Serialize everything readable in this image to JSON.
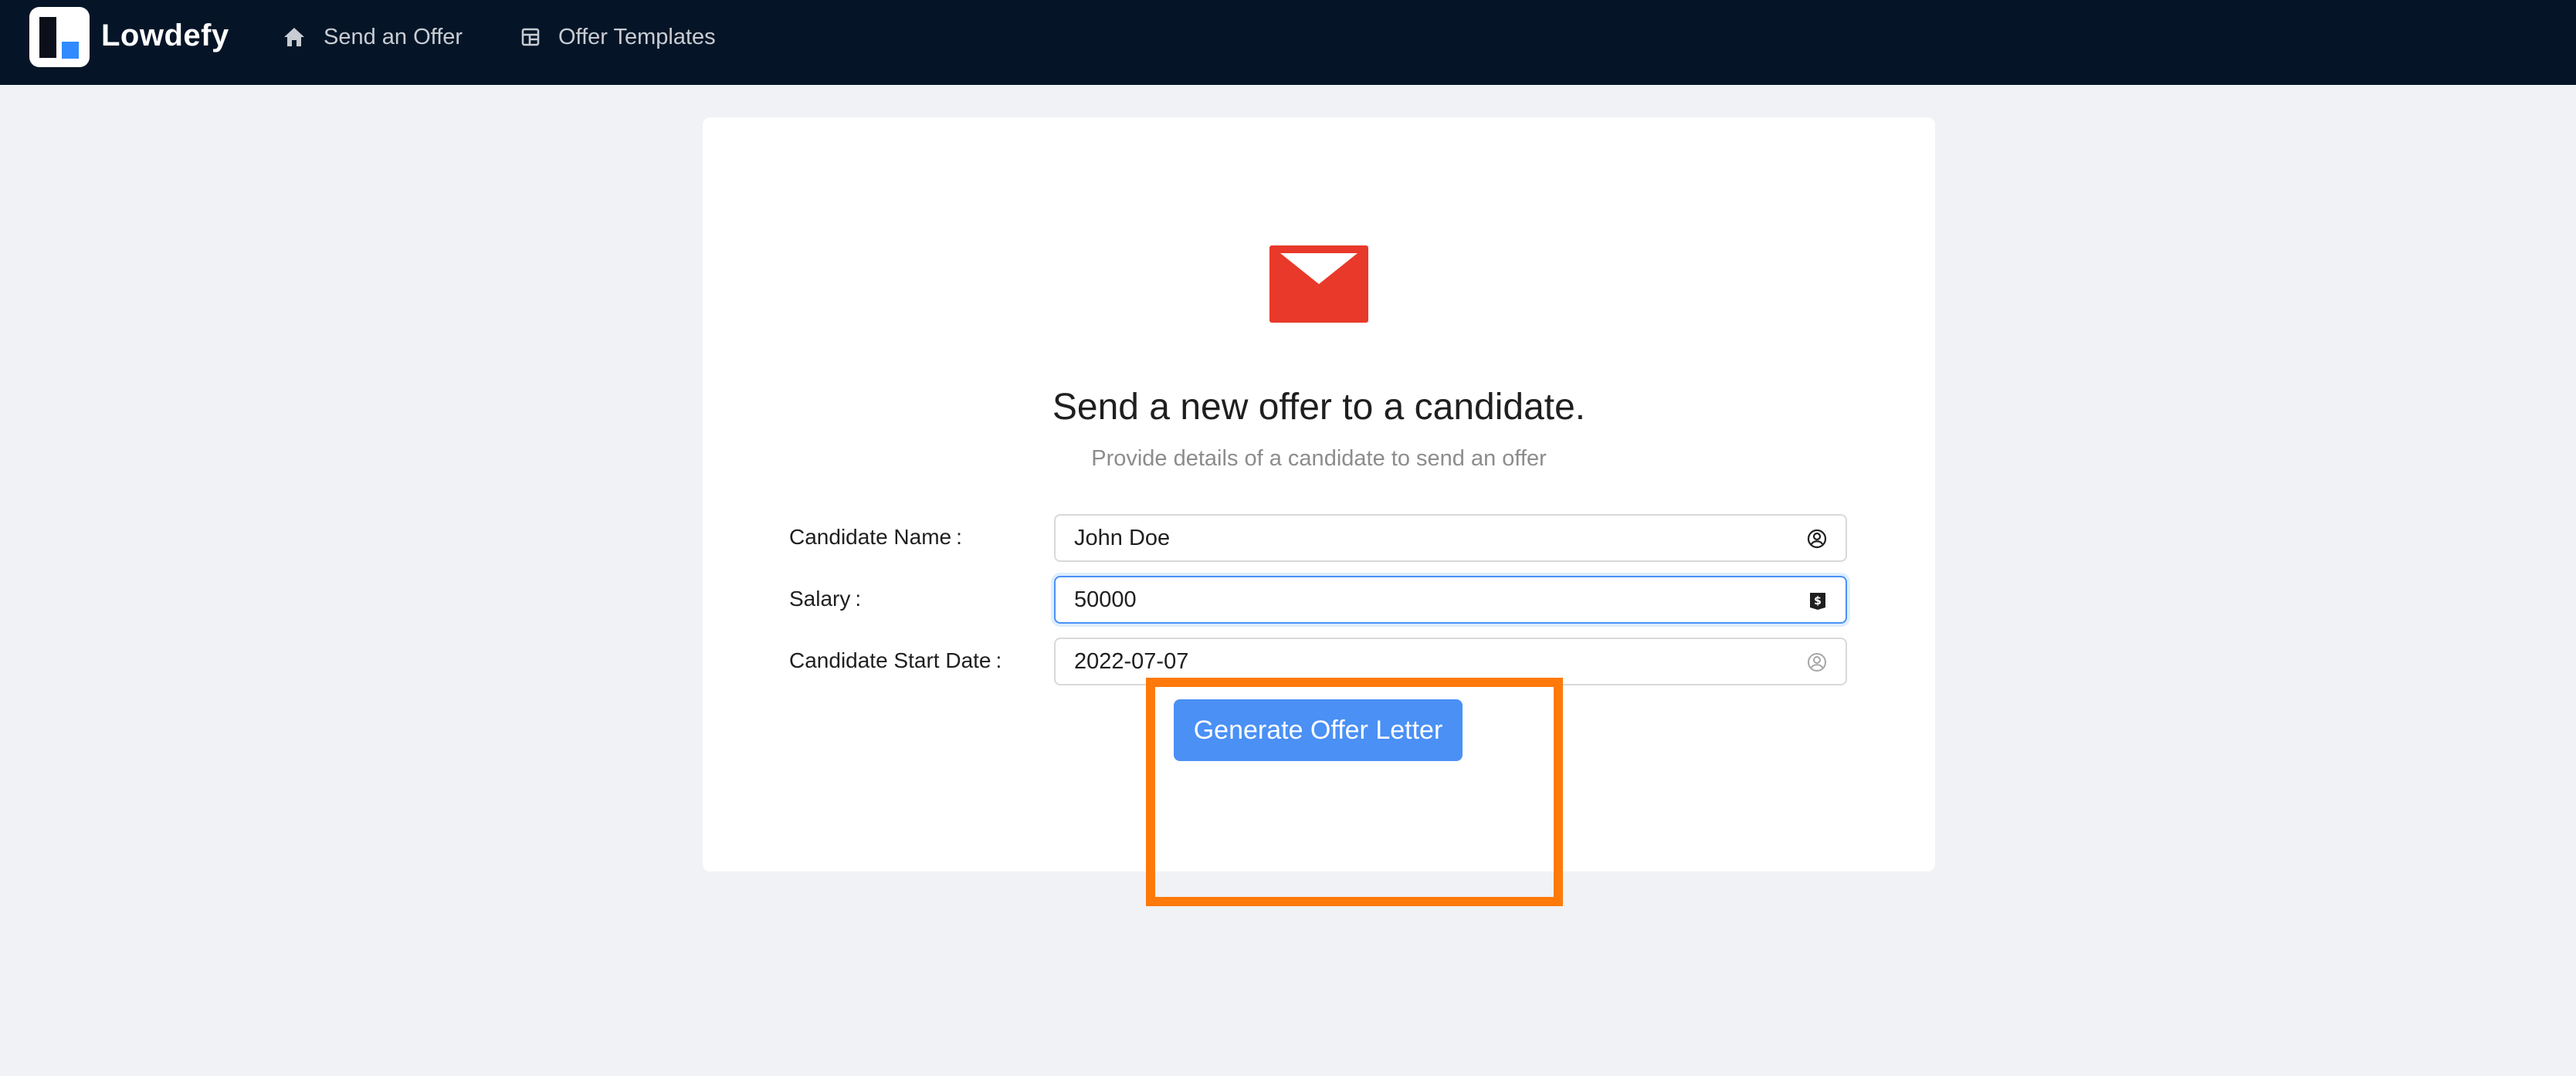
{
  "header": {
    "brand": "Lowdefy",
    "nav": [
      {
        "label": "Send an Offer",
        "icon": "home-icon"
      },
      {
        "label": "Offer Templates",
        "icon": "layout-icon"
      }
    ]
  },
  "page": {
    "icon": "mail-icon",
    "title": "Send a new offer to a candidate.",
    "subtitle": "Provide details of a candidate to send an offer"
  },
  "form": {
    "fields": [
      {
        "label": "Candidate Name",
        "value": "John Doe",
        "icon": "user-circle-icon"
      },
      {
        "label": "Salary",
        "value": "50000",
        "icon": "currency-icon",
        "focused": true
      },
      {
        "label": "Candidate Start Date",
        "value": "2022-07-07",
        "icon": "user-circle-icon"
      }
    ],
    "submit_label": "Generate Offer Letter"
  },
  "colors": {
    "header_bg": "#051527",
    "page_bg": "#f0f2f5",
    "primary": "#4a90f5",
    "mail_icon": "#e8392a",
    "highlight": "#ff7a0a"
  }
}
